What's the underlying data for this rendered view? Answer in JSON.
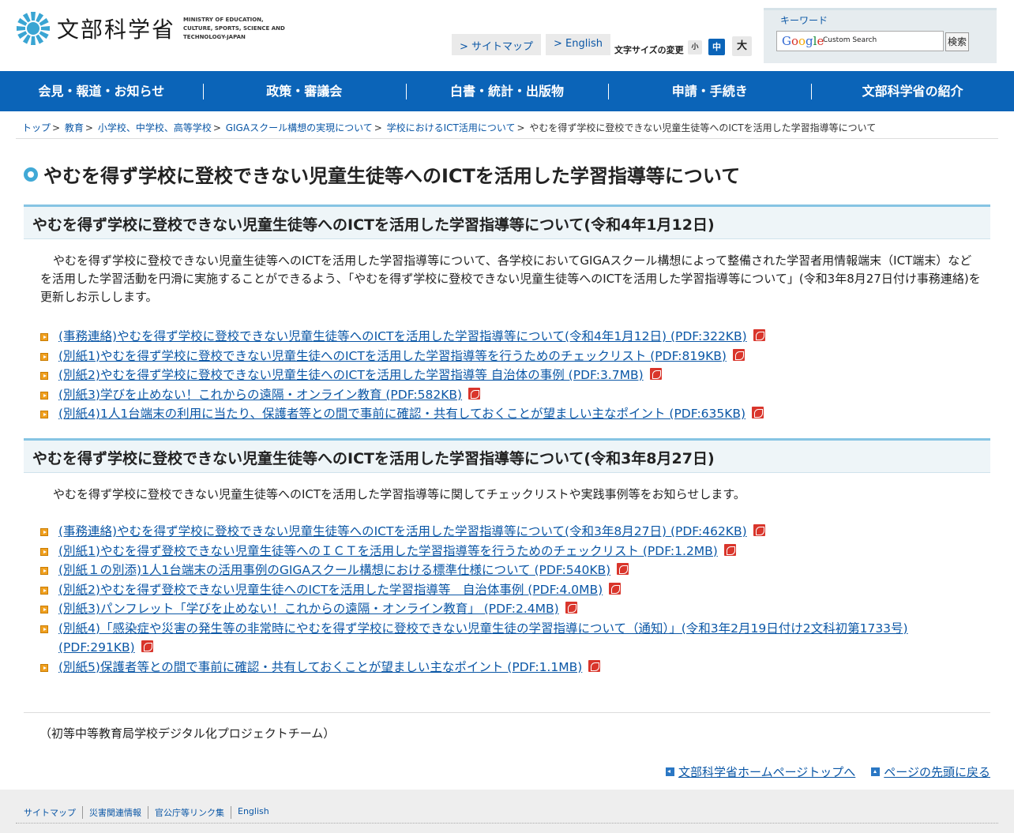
{
  "header": {
    "logo_name": "文部科学省",
    "logo_en": "MINISTRY OF EDUCATION, CULTURE, SPORTS, SCIENCE AND TECHNOLOGY-JAPAN",
    "sitemap_label": "> サイトマップ",
    "english_label": "> English",
    "font_size_label": "文字サイズの変更",
    "font_small": "小",
    "font_medium": "中",
    "font_large": "大",
    "search_label": "キーワード",
    "google_word": "Google",
    "search_placeholder": "Custom Search",
    "search_button": "検索"
  },
  "nav": [
    {
      "label": "会見・報道・お知らせ"
    },
    {
      "label": "政策・審議会"
    },
    {
      "label": "白書・統計・出版物"
    },
    {
      "label": "申請・手続き"
    },
    {
      "label": "文部科学省の紹介"
    }
  ],
  "breadcrumb": [
    {
      "label": "トップ"
    },
    {
      "label": "教育"
    },
    {
      "label": "小学校、中学校、高等学校"
    },
    {
      "label": "GIGAスクール構想の実現について"
    },
    {
      "label": "学校におけるICT活用について"
    }
  ],
  "breadcrumb_current": "やむを得ず学校に登校できない児童生徒等へのICTを活用した学習指導等について",
  "page_title": "やむを得ず学校に登校できない児童生徒等へのICTを活用した学習指導等について",
  "sections": [
    {
      "heading": "やむを得ず学校に登校できない児童生徒等へのICTを活用した学習指導等について(令和4年1月12日)",
      "description": "やむを得ず学校に登校できない児童生徒等へのICTを活用した学習指導等について、各学校においてGIGAスクール構想によって整備された学習者用情報端末（ICT端末）などを活用した学習活動を円滑に実施することができるよう、「やむを得ず学校に登校できない児童生徒等へのICTを活用した学習指導等について」(令和3年8月27日付け事務連絡)を更新しお示しします。",
      "docs": [
        {
          "label": "(事務連絡)やむを得ず学校に登校できない児童生徒等へのICTを活用した学習指導等について(令和4年1月12日) (PDF:322KB)"
        },
        {
          "label": "(別紙1)やむを得ず学校に登校できない児童生徒へのICTを活用した学習指導等を行うためのチェックリスト (PDF:819KB)"
        },
        {
          "label": "(別紙2)やむを得ず学校に登校できない児童生徒へのICTを活用した学習指導等 自治体の事例 (PDF:3.7MB)"
        },
        {
          "label": "(別紙3)学びを止めない！これからの遠隔・オンライン教育 (PDF:582KB)"
        },
        {
          "label": "(別紙4)1人1台端末の利用に当たり、保護者等との間で事前に確認・共有しておくことが望ましい主なポイント (PDF:635KB)"
        }
      ]
    },
    {
      "heading": "やむを得ず学校に登校できない児童生徒等へのICTを活用した学習指導等について(令和3年8月27日)",
      "description": "やむを得ず学校に登校できない児童生徒等へのICTを活用した学習指導等に関してチェックリストや実践事例等をお知らせします。",
      "docs": [
        {
          "label": "(事務連絡)やむを得ず学校に登校できない児童生徒等へのICTを活用した学習指導等について(令和3年8月27日) (PDF:462KB)"
        },
        {
          "label": "(別紙1)やむを得ず登校できない児童生徒等へのＩＣＴを活用した学習指導等を行うためのチェックリスト (PDF:1.2MB)"
        },
        {
          "label": "(別紙１の別添)1人1台端末の活用事例のGIGAスクール構想における標準仕様について (PDF:540KB)"
        },
        {
          "label": "(別紙2)やむを得ず登校できない児童生徒へのICTを活用した学習指導等　自治体事例 (PDF:4.0MB)"
        },
        {
          "label": "(別紙3)パンフレット「学びを止めない！これからの遠隔・オンライン教育」 (PDF:2.4MB)"
        },
        {
          "label": "(別紙4)「感染症や災害の発生等の非常時にやむを得ず学校に登校できない児童生徒の学習指導について（通知）」(令和3年2月19日付け2文科初第1733号) (PDF:291KB)"
        },
        {
          "label": "(別紙5)保護者等との間で事前に確認・共有しておくことが望ましい主なポイント (PDF:1.1MB)"
        }
      ]
    }
  ],
  "contact": "（初等中等教育局学校デジタル化プロジェクトチーム）",
  "bottom_links": {
    "home": "文部科学省ホームページトップへ",
    "page_top": "ページの先頭に戻る"
  },
  "footer": {
    "row1": [
      "サイトマップ",
      "災害関連情報",
      "官公庁等リンク集",
      "English"
    ]
  },
  "colors": {
    "nav_bg": "#0b64b8",
    "link": "#0b57a6",
    "accent": "#41a9d6",
    "pdf_icon": "#d9352b",
    "bullet": "#f0a020"
  }
}
